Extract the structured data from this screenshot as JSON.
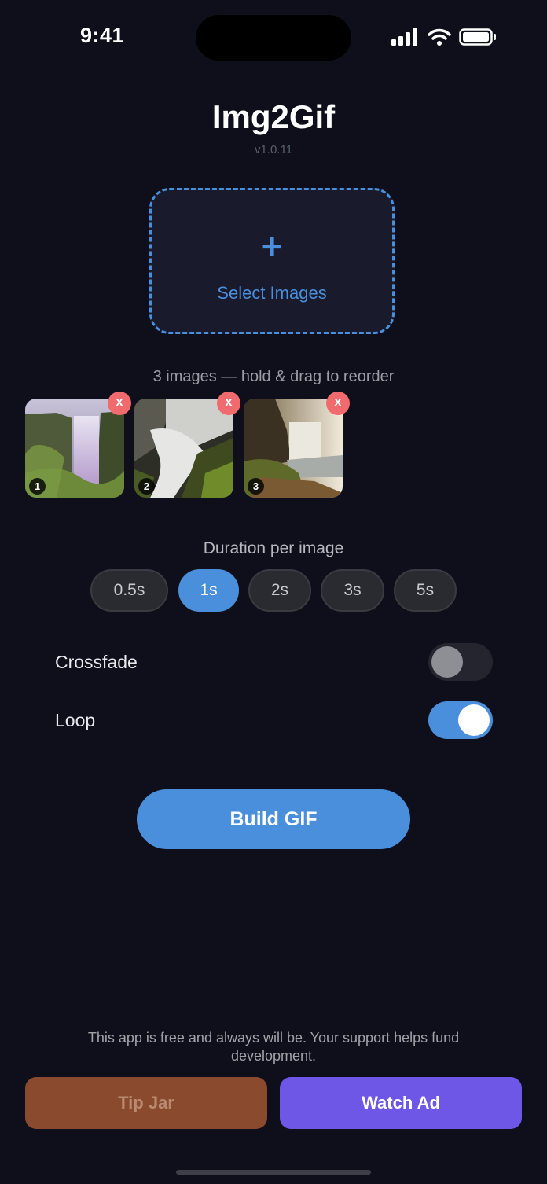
{
  "status_bar": {
    "time": "9:41"
  },
  "header": {
    "title": "Img2Gif",
    "version": "v1.0.11"
  },
  "picker": {
    "plus_icon": "plus-icon",
    "label": "Select Images"
  },
  "images": {
    "hint": "3 images — hold & drag to reorder",
    "remove_label": "x",
    "items": [
      {
        "index": "1"
      },
      {
        "index": "2"
      },
      {
        "index": "3"
      }
    ]
  },
  "duration": {
    "label": "Duration per image",
    "options": [
      "0.5s",
      "1s",
      "2s",
      "3s",
      "5s"
    ],
    "selected": "1s"
  },
  "settings": {
    "crossfade": {
      "label": "Crossfade",
      "on": false
    },
    "loop": {
      "label": "Loop",
      "on": true
    }
  },
  "actions": {
    "build_label": "Build GIF"
  },
  "footer": {
    "support_text": "This app is free and always will be. Your support helps fund development.",
    "tip_label": "Tip Jar",
    "ad_label": "Watch Ad"
  },
  "colors": {
    "background": "#0e0f1a",
    "accent": "#4a8fdc",
    "remove": "#f06a6e",
    "tip": "#8a4a2e",
    "ad": "#6e56e6"
  }
}
